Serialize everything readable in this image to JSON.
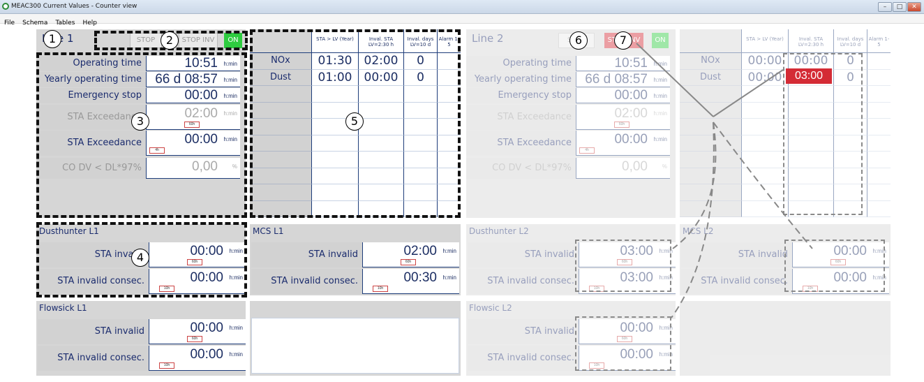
{
  "window": {
    "title": "MEAC300 Current Values - Counter view",
    "min": "–",
    "max": "□",
    "close": "✕"
  },
  "menu": [
    "File",
    "Schema",
    "Tables",
    "Help"
  ],
  "callouts": [
    "1",
    "2",
    "3",
    "4",
    "5",
    "6",
    "7"
  ],
  "line1": {
    "title": "Line 1",
    "stop": "STOP",
    "stop_inv": "STOP INV",
    "on": "ON",
    "rows": [
      {
        "label": "Operating time",
        "value": "10:51",
        "unit": "h:min"
      },
      {
        "label": "Yearly operating time",
        "value": "66 d 08:57",
        "unit": "h:min"
      },
      {
        "label": "Emergency stop",
        "value": "00:00",
        "unit": "h:min"
      },
      {
        "label": "STA Exceedance",
        "value": "02:00",
        "unit": "h:min",
        "tag": "60h"
      },
      {
        "label": "STA Exceedance consec.",
        "value": "00:00",
        "unit": "h:min",
        "tag": "4h"
      },
      {
        "label": "CO DV < DL*97%",
        "value": "0,00",
        "unit": "%"
      }
    ],
    "table": {
      "headers": [
        "STA > LV (Year)",
        "Inval. STA LV=2:30 h",
        "Inval. days LV=10 d",
        "Alarm 1-5"
      ],
      "rows": [
        {
          "name": "NOx",
          "v": [
            "01:30",
            "02:00",
            "0",
            ""
          ]
        },
        {
          "name": "Dust",
          "v": [
            "01:00",
            "00:00",
            "0",
            ""
          ]
        }
      ]
    },
    "dusthunter": {
      "title": "Dusthunter L1",
      "rows": [
        {
          "label": "STA invalid",
          "value": "00:00",
          "unit": "h:min",
          "tag": "60h"
        },
        {
          "label": "STA invalid consec.",
          "value": "00:00",
          "unit": "h:min",
          "tag": "10h"
        }
      ]
    },
    "mcs": {
      "title": "MCS L1",
      "rows": [
        {
          "label": "STA invalid",
          "value": "02:00",
          "unit": "h:min",
          "tag": "60h"
        },
        {
          "label": "STA invalid consec.",
          "value": "00:30",
          "unit": "h:min",
          "tag": "10h"
        }
      ]
    },
    "flowsick": {
      "title": "Flowsick L1",
      "rows": [
        {
          "label": "STA invalid",
          "value": "00:00",
          "unit": "h:min",
          "tag": "60h"
        },
        {
          "label": "STA invalid consec.",
          "value": "00:00",
          "unit": "h:min",
          "tag": "10h"
        }
      ]
    }
  },
  "line2": {
    "title": "Line 2",
    "stop": "STOP",
    "stop_inv": "STOP INV",
    "on": "ON",
    "rows": [
      {
        "label": "Operating time",
        "value": "10:51",
        "unit": "h:min"
      },
      {
        "label": "Yearly operating time",
        "value": "66 d 08:57",
        "unit": "h:min"
      },
      {
        "label": "Emergency stop",
        "value": "00:00",
        "unit": "h:min"
      },
      {
        "label": "STA Exceedance",
        "value": "02:00",
        "unit": "h:min",
        "tag": "60h"
      },
      {
        "label": "STA Exceedance consec.",
        "value": "00:00",
        "unit": "h:min",
        "tag": "4h"
      },
      {
        "label": "CO DV < DL*97%",
        "value": "0,00",
        "unit": "%"
      }
    ],
    "table": {
      "headers": [
        "STA > LV (Year)",
        "Inval. STA LV=2:30 h",
        "Inval. days LV=10 d",
        "Alarm 1-5"
      ],
      "rows": [
        {
          "name": "NOx",
          "v": [
            "00:00",
            "00:00",
            "0",
            ""
          ]
        },
        {
          "name": "Dust",
          "v": [
            "00:00",
            "03:00",
            "0",
            ""
          ]
        }
      ]
    },
    "dusthunter": {
      "title": "Dusthunter L2",
      "rows": [
        {
          "label": "STA invalid",
          "value": "03:00",
          "unit": "h:min",
          "tag": "60h"
        },
        {
          "label": "STA invalid consec.",
          "value": "03:00",
          "unit": "h:min",
          "tag": "10h"
        }
      ]
    },
    "mcs": {
      "title": "MCS L2",
      "rows": [
        {
          "label": "STA invalid",
          "value": "00:00",
          "unit": "h:min",
          "tag": "60h"
        },
        {
          "label": "STA invalid consec.",
          "value": "00:00",
          "unit": "h:min",
          "tag": "10h"
        }
      ]
    },
    "flowsic": {
      "title": "Flowsic L2",
      "rows": [
        {
          "label": "STA invalid",
          "value": "00:00",
          "unit": "h:min",
          "tag": "60h"
        },
        {
          "label": "STA invalid consec.",
          "value": "00:00",
          "unit": "h:min",
          "tag": "10h"
        }
      ]
    }
  },
  "colors": {
    "accent": "#1e3d7a",
    "on": "#2ecc40",
    "alarm": "#d42b35",
    "panel": "#d6d6d6"
  }
}
